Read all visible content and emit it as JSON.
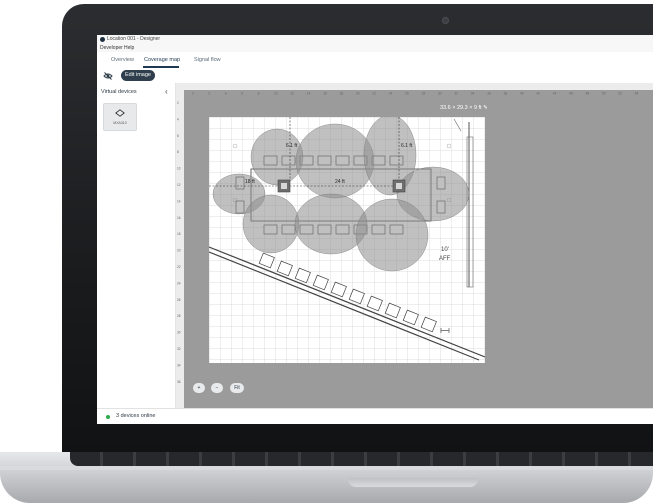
{
  "window": {
    "title": "Location 001 - Designer",
    "menu": [
      "Developer",
      "Help"
    ]
  },
  "tabs": [
    {
      "label": "Overview",
      "active": false
    },
    {
      "label": "Coverage map",
      "active": true
    },
    {
      "label": "Signal flow",
      "active": false
    }
  ],
  "toolbar": {
    "edit_image_label": "Edit image",
    "visibility_icon": "eye-off-icon"
  },
  "sidebar": {
    "title": "Virtual devices",
    "collapse_glyph": "‹",
    "device": {
      "label": "MXA310",
      "icon": "ceiling-mic-icon"
    }
  },
  "map": {
    "room_dimensions": "33.6 × 29.3 × 9 ft",
    "ruler_top": [
      "0",
      "2",
      "4",
      "6",
      "8",
      "10",
      "12",
      "14",
      "16",
      "18",
      "20",
      "22",
      "24",
      "26",
      "28",
      "30",
      "32",
      "34",
      "36",
      "38",
      "40",
      "42",
      "44",
      "46",
      "48",
      "50",
      "52",
      "54"
    ],
    "ruler_left": [
      "2",
      "4",
      "6",
      "8",
      "10",
      "12",
      "14",
      "16",
      "18",
      "20",
      "22",
      "24",
      "26",
      "28",
      "30",
      "32",
      "34",
      "36"
    ],
    "measurements": [
      "6.1 ft",
      "18 ft",
      "24 ft",
      "6.1 ft"
    ],
    "ceiling_label_line1": "10'",
    "ceiling_label_line2": "AFF",
    "coverage_lobes": 8,
    "devices_on_map": 2
  },
  "zoom": {
    "zoom_in_glyph": "+",
    "zoom_out_glyph": "−",
    "fit_label": "Fit"
  },
  "status": {
    "text": "3 devices online",
    "color": "#2faa4a"
  },
  "colors": {
    "accent": "#2e3e4c",
    "canvas": "#9b9b9b",
    "coverage_fill": "#8c8c8c"
  }
}
